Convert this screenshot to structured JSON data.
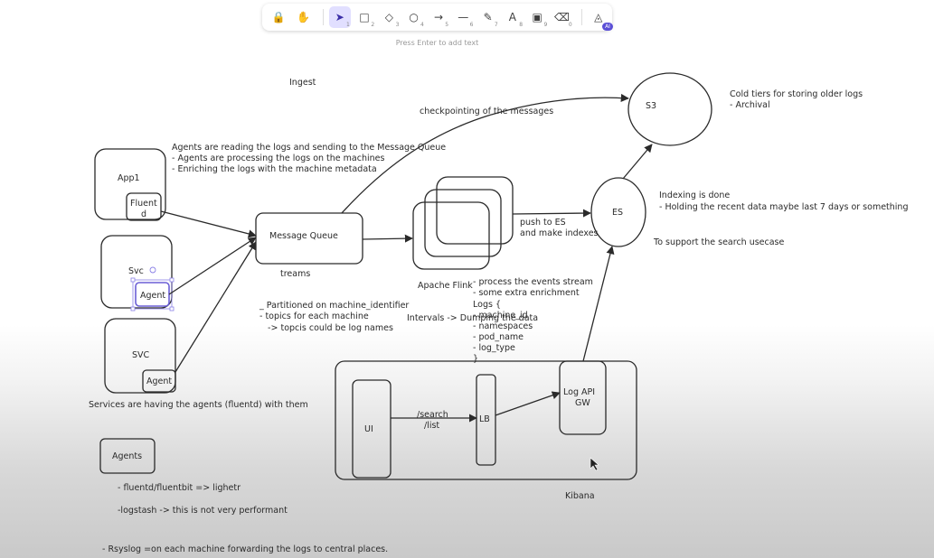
{
  "toolbar": {
    "tools": [
      {
        "icon": "lock-icon",
        "glyph": "🔒",
        "num": ""
      },
      {
        "icon": "hand-icon",
        "glyph": "✋",
        "num": ""
      },
      {
        "icon": "pointer-icon",
        "glyph": "➤",
        "num": "1",
        "active": true
      },
      {
        "icon": "rectangle-icon",
        "glyph": "□",
        "num": "2"
      },
      {
        "icon": "diamond-icon",
        "glyph": "◇",
        "num": "3"
      },
      {
        "icon": "ellipse-icon",
        "glyph": "○",
        "num": "4"
      },
      {
        "icon": "arrow-icon",
        "glyph": "→",
        "num": "5"
      },
      {
        "icon": "line-icon",
        "glyph": "—",
        "num": "6"
      },
      {
        "icon": "pencil-icon",
        "glyph": "✎",
        "num": "7"
      },
      {
        "icon": "text-icon",
        "glyph": "A",
        "num": "8"
      },
      {
        "icon": "image-icon",
        "glyph": "▣",
        "num": "9"
      },
      {
        "icon": "eraser-icon",
        "glyph": "⌫",
        "num": "0"
      }
    ],
    "ai_tool": {
      "icon": "shapes-icon",
      "glyph": "◬",
      "badge": "AI"
    }
  },
  "hint": "Press Enter to add text",
  "diagram": {
    "ingest": "Ingest",
    "app1": "App1",
    "fluentd": [
      "Fluent",
      "d"
    ],
    "svc1": "Svc",
    "agent1": "Agent",
    "svc2": "SVC",
    "agent2": "Agent",
    "agents_box": "Agents",
    "message_queue": "Message Queue",
    "streams": "treams",
    "apache_flink": "Apache Flink",
    "es": "ES",
    "s3": "S3",
    "ui": "UI",
    "lb": "LB",
    "gw": [
      "Log API",
      "GW"
    ],
    "kibana": "Kibana",
    "checkpointing": "checkpointing of the messages",
    "push_to_es": [
      "push to ES",
      "and make indexes"
    ],
    "search_list": [
      "/search",
      "/list"
    ],
    "notes_agents": [
      "Agents are reading the logs and sending to the Message Queue",
      "- Agents are processing the logs on the machines",
      "- Enriching the logs with the machine metadata"
    ],
    "notes_cold": [
      "Cold tiers for storing older logs",
      "- Archival"
    ],
    "notes_index": [
      "Indexing is done",
      "- Holding the recent data maybe last 7 days or something"
    ],
    "notes_search": "To support the search usecase",
    "notes_partition": [
      "_ Partitioned on machine_identifier",
      "- topics for each machine",
      "   -> topcis could be log names"
    ],
    "notes_flink": [
      "- process the events stream",
      "- some extra enrichment",
      "Logs {",
      "- machine_id",
      "- namespaces",
      "- pod_name",
      "- log_type",
      "}"
    ],
    "intervals": "Intervals -> Dumping the data",
    "services_note": "Services are having the agents (fluentd) with them",
    "agent_notes": [
      "- fluentd/fluentbit => lighetr",
      "-logstash -> this is not very performant",
      "- Rsyslog =on each machine forwarding the logs to central places."
    ]
  }
}
